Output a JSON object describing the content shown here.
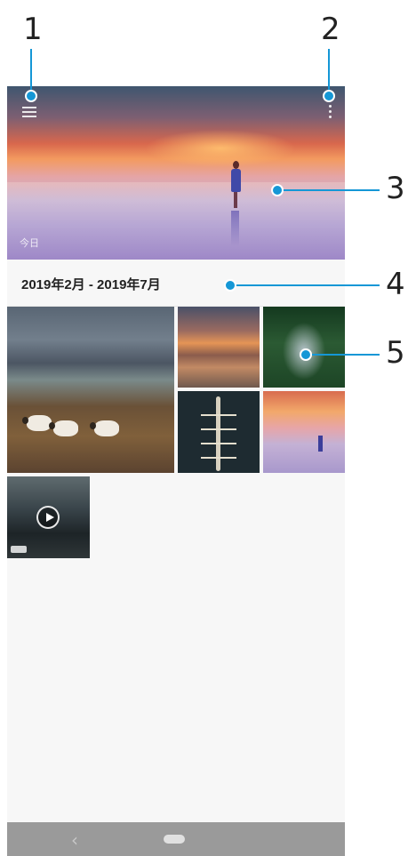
{
  "callouts": [
    "1",
    "2",
    "3",
    "4",
    "5"
  ],
  "header": {
    "hero_label": "今日",
    "menu_icon": "hamburger-menu-icon",
    "more_icon": "more-vert-icon"
  },
  "gallery": {
    "date_range": "2019年2月 - 2019年7月"
  },
  "navbar": {
    "back_icon": "back-chevron-icon",
    "home_icon": "home-pill-icon",
    "back_glyph": "‹"
  },
  "colors": {
    "accent": "#1597d6",
    "navbar": "#9a9a9a",
    "background": "#f7f7f7"
  }
}
